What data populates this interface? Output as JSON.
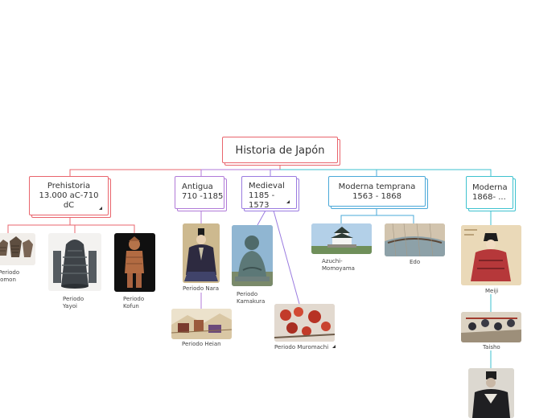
{
  "title": "Historia de Japón",
  "branches": {
    "prehistoria": {
      "label_line1": "Prehistoria",
      "label_line2": "13.000 aC-710",
      "label_line3": "dC"
    },
    "antigua": {
      "label_line1": "Antigua",
      "label_line2": "710 -1185"
    },
    "medieval": {
      "label_line1": "Medieval",
      "label_line2": "1185 -",
      "label_line3": "1573"
    },
    "moderna_temprana": {
      "label_line1": "Moderna temprana",
      "label_line2": "1563 - 1868"
    },
    "moderna": {
      "label_line1": "Moderna",
      "label_line2": "1868- ..."
    }
  },
  "periods": {
    "jomon": {
      "line1": "Periodo",
      "line2": "Jomon"
    },
    "yayoi": {
      "line1": "Periodo",
      "line2": "Yayoi"
    },
    "kofun": {
      "line1": "Periodo",
      "line2": "Kofun"
    },
    "nara": "Periodo Nara",
    "heian": "Periodo Heian",
    "kamakura": {
      "line1": "Periodo",
      "line2": "Kamakura"
    },
    "muromachi": "Periodo Muromachi",
    "azuchi": {
      "line1": "Azuchi-",
      "line2": "Momoyama"
    },
    "edo": "Edo",
    "meiji": "Meiji",
    "taisho": "Taisho"
  },
  "colors": {
    "prehistoria": "#e9646c",
    "antigua": "#a07ad8",
    "medieval": "#9a7be0",
    "moderna_temprana": "#4aa8d8",
    "moderna": "#3ec2cf"
  }
}
